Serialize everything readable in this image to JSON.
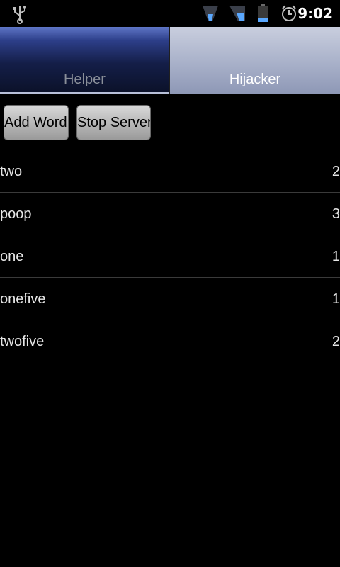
{
  "status_bar": {
    "time": "9:02",
    "icons": [
      "usb-icon",
      "wifi-icon",
      "signal-icon",
      "battery-icon",
      "alarm-icon"
    ]
  },
  "tabs": [
    {
      "label": "Helper",
      "selected": false
    },
    {
      "label": "Hijacker",
      "selected": true
    }
  ],
  "toolbar": {
    "add_word_label": "Add Word",
    "stop_server_label": "Stop Server"
  },
  "words": [
    {
      "word": "two",
      "count": "2"
    },
    {
      "word": "poop",
      "count": "3"
    },
    {
      "word": "one",
      "count": "1"
    },
    {
      "word": "onefive",
      "count": "1"
    },
    {
      "word": "twofive",
      "count": "2"
    }
  ],
  "colors": {
    "background": "#000000",
    "selected_tab": "#aeb6cd",
    "unselected_tab": "#141e48",
    "divider": "#3a3a3a"
  }
}
